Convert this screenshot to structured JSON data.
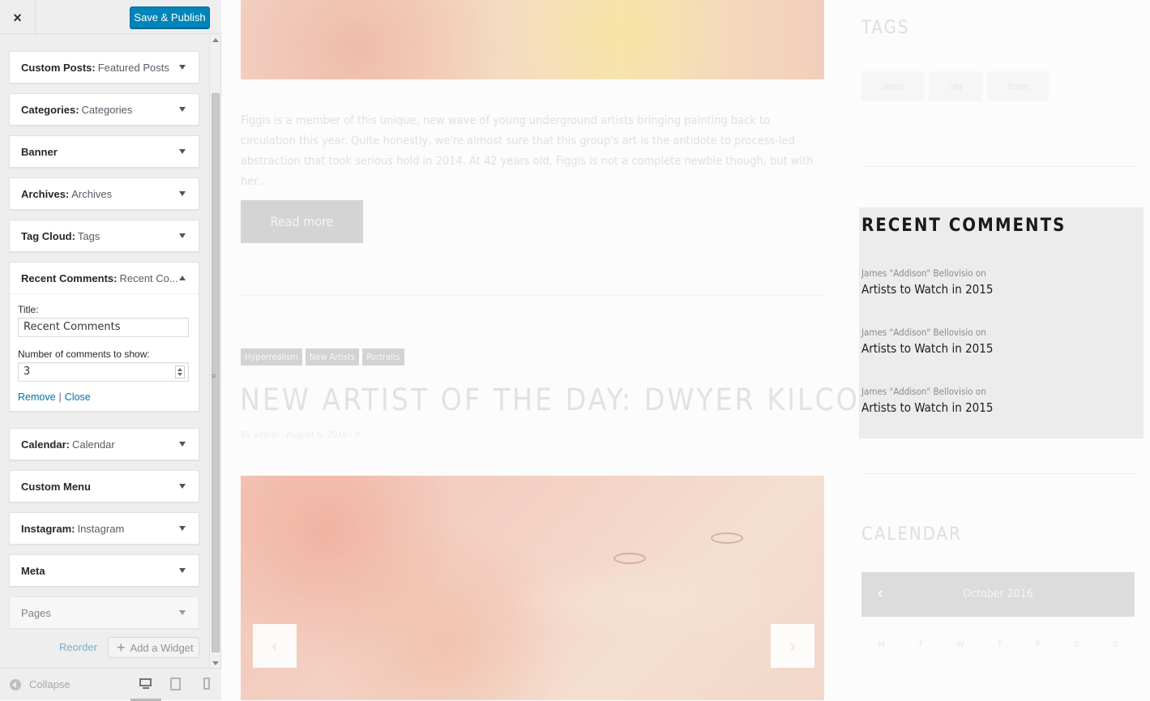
{
  "customizer": {
    "close_label": "×",
    "publish_label": "Save & Publish",
    "widgets": [
      {
        "type": "Custom Posts:",
        "title": "Featured Posts"
      },
      {
        "type": "Categories:",
        "title": "Categories"
      },
      {
        "type": "Banner",
        "title": ""
      },
      {
        "type": "Archives:",
        "title": "Archives"
      },
      {
        "type": "Tag Cloud:",
        "title": "Tags"
      },
      {
        "type": "Recent Comments:",
        "title": "Recent Co..."
      },
      {
        "type": "Calendar:",
        "title": "Calendar"
      },
      {
        "type": "Custom Menu",
        "title": ""
      },
      {
        "type": "Instagram:",
        "title": "Instagram"
      },
      {
        "type": "Meta",
        "title": ""
      },
      {
        "type": "Pages",
        "title": ""
      }
    ],
    "expanded_form": {
      "title_label": "Title:",
      "title_value": "Recent Comments",
      "count_label": "Number of comments to show:",
      "count_value": "3",
      "remove_label": "Remove",
      "separator": "|",
      "close_label": "Close"
    },
    "reorder_label": "Reorder",
    "add_widget_label": "Add a Widget",
    "collapse_label": "Collapse"
  },
  "preview": {
    "excerpt": "Figgis is a member of this unique, new wave of young underground artists bringing painting back to circulation this year. Quite honestly, we're almost sure that this group's art is the antidote to process-led abstraction that took serious hold in 2014. At 42 years old, Figgis is not a complete newbie though, but with her…",
    "read_more": "Read more",
    "post_tags": [
      "Hyperrealism",
      "New Artists",
      "Portraits"
    ],
    "post_title": "NEW ARTIST OF THE DAY: DWYER KILCOLLIN",
    "post_meta": "By admin · August 6, 2016 · 0",
    "slider_prev": "‹",
    "slider_next": "›",
    "tags_title": "TAGS",
    "tag_cloud": [
      "some",
      "tag",
      "there"
    ],
    "recent_comments_title": "RECENT COMMENTS",
    "recent_comments": [
      {
        "author": "James \"Addison\" Bellovisio on",
        "post": "Artists to Watch in 2015"
      },
      {
        "author": "James \"Addison\" Bellovisio on",
        "post": "Artists to Watch in 2015"
      },
      {
        "author": "James \"Addison\" Bellovisio on",
        "post": "Artists to Watch in 2015"
      }
    ],
    "calendar_title": "CALENDAR",
    "calendar_month": "October 2016",
    "calendar_prev": "‹",
    "calendar_days": [
      "M",
      "T",
      "W",
      "T",
      "F",
      "S",
      "S"
    ]
  }
}
